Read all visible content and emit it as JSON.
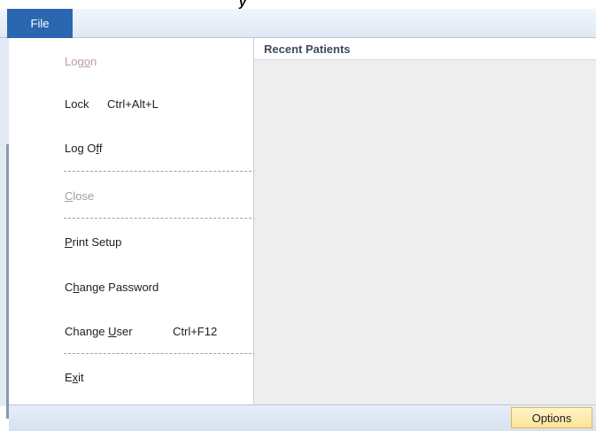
{
  "ribbon": {
    "file_tab_label": "File"
  },
  "menu": {
    "logon": {
      "pre": "Log",
      "mnemonic": "o",
      "post": "n"
    },
    "lock": {
      "label": "Lock",
      "shortcut": "Ctrl+Alt+L"
    },
    "logoff": {
      "pre": "Log O",
      "mnemonic": "f",
      "post": "f"
    },
    "close": {
      "pre": "",
      "mnemonic": "C",
      "post": "lose"
    },
    "print_setup": {
      "pre": "",
      "mnemonic": "P",
      "post": "rint Setup"
    },
    "change_password": {
      "pre": "C",
      "mnemonic": "h",
      "post": "ange Password"
    },
    "change_user": {
      "pre": "Change ",
      "mnemonic": "U",
      "post": "ser",
      "shortcut": "Ctrl+F12"
    },
    "exit": {
      "pre": "E",
      "mnemonic": "x",
      "post": "it"
    }
  },
  "recent": {
    "title": "Recent Patients"
  },
  "status": {
    "options_label": "Options"
  }
}
